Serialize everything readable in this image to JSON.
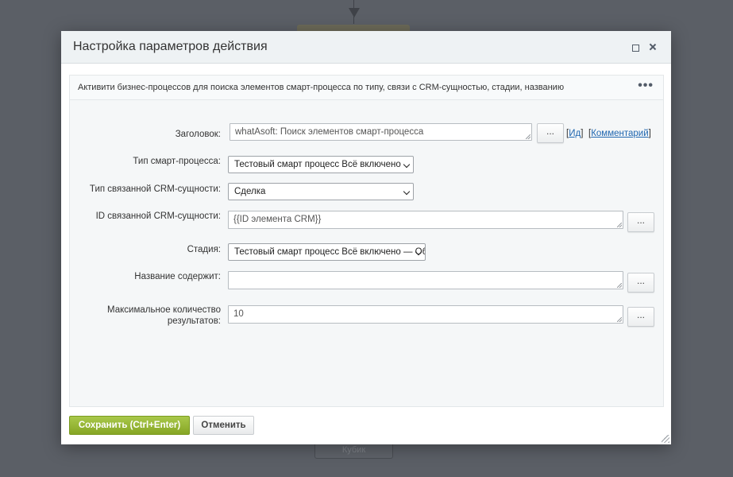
{
  "background": {
    "bottom_block_label": "Кубик"
  },
  "dialog": {
    "title": "Настройка параметров действия",
    "description": "Активити бизнес-процессов для поиска элементов смарт-процесса по типу, связи с CRM-сущностью, стадии, названию",
    "more_label": "•••"
  },
  "form": {
    "title_label": "Заголовок:",
    "title_value": "whatAsoft: Поиск элементов смарт-процесса",
    "id_link": "Ид",
    "comment_link": "Комментарий",
    "type_label": "Тип смарт-процесса:",
    "type_value": "Тестовый смарт процесс Всё включено",
    "crm_type_label": "Тип связанной CRM-сущности:",
    "crm_type_value": "Сделка",
    "crm_id_label": "ID связанной CRM-сущности:",
    "crm_id_value": "{{ID элемента CRM}}",
    "stage_label": "Стадия:",
    "stage_value": "Тестовый смарт процесс Всё включено — Об",
    "name_label": "Название содержит:",
    "name_value": "",
    "max_label_line1": "Максимальное количество",
    "max_label_line2": "результатов:",
    "max_value": "10",
    "dots_label": "..."
  },
  "footer": {
    "save_label": "Сохранить (Ctrl+Enter)",
    "cancel_label": "Отменить"
  }
}
